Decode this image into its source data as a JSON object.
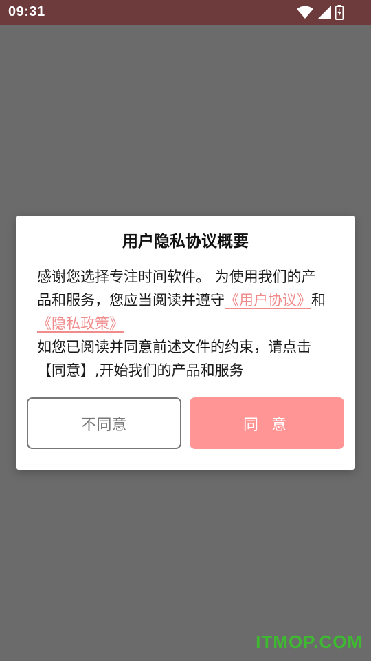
{
  "status_bar": {
    "time": "09:31",
    "icons": [
      "wifi-icon",
      "cell-signal-icon",
      "battery-charging-icon"
    ]
  },
  "dialog": {
    "title": "用户隐私协议概要",
    "body": {
      "text_1": "感谢您选择专注时间软件。 为使用我们的产品和服务，您应当阅读并遵守",
      "link_user_agreement": "《用户协议》",
      "text_and": "和",
      "link_privacy_policy": "《隐私政策》",
      "text_2": "如您已阅读并同意前述文件的约束，请点击【同意】,开始我们的产品和服务"
    },
    "buttons": {
      "disagree": "不同意",
      "agree": "同 意"
    }
  },
  "watermark": "ITMOP.COM",
  "colors": {
    "status_bar": "#6e3b3d",
    "backdrop": "#6b6b6b",
    "accent": "#ff9595",
    "link": "#f08c8c",
    "watermark": "#3fb832"
  }
}
